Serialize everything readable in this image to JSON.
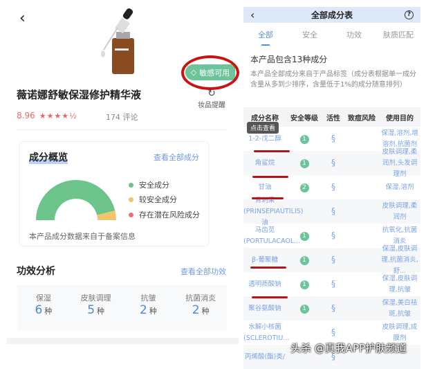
{
  "left": {
    "back_icon": "chevron-left",
    "badge": "敏感可用",
    "remind_label": "妆品提醒",
    "product_name": "薇诺娜舒敏保湿修护精华液",
    "score": "8.96",
    "stars": "★★★★½",
    "star_rating": 4.5,
    "reviews": "174 评论",
    "overview": {
      "title": "成分概览",
      "link": "查看全部成分",
      "legend": [
        {
          "label": "安全成分",
          "color": "#6cc48a"
        },
        {
          "label": "较安全成分",
          "color": "#f2c46e"
        },
        {
          "label": "存在潜在风险成分",
          "color": "#e6717a"
        }
      ],
      "gauge": {
        "safe": 12,
        "fairly_safe": 1,
        "risk": 0
      },
      "footnote": "本产品成分数据来自于备案信息"
    },
    "efficacy": {
      "title": "功效分析",
      "link": "查看全部功效",
      "items": [
        {
          "label": "保湿",
          "count": "6",
          "unit": "种"
        },
        {
          "label": "皮肤调理",
          "count": "5",
          "unit": "种"
        },
        {
          "label": "抗皱",
          "count": "2",
          "unit": "种"
        },
        {
          "label": "抗菌消炎",
          "count": "2",
          "unit": "种"
        }
      ]
    }
  },
  "right": {
    "title": "全部成分表",
    "help_icon": "?",
    "tabs": [
      "全部",
      "安全",
      "功效",
      "肤质匹配"
    ],
    "count_text": "本产品包含13种成分",
    "description": "本产品全部成分来自于产品标签（成分表根据单一成分含量从多到少排序，含量低于1%的成分随意排列）",
    "columns": [
      "成分名称",
      "安全等级",
      "活性",
      "致痘风险",
      "使用目的"
    ],
    "tooltip": "点击查看",
    "rows": [
      {
        "name": "1-2-戊二醇",
        "grade": "1",
        "purpose": "保湿,溶剂,增溶剂,抗菌剂"
      },
      {
        "name": "角鲨烷",
        "grade": "1",
        "purpose": "皮肤调理,柔润剂,头发调理剂"
      },
      {
        "name": "甘油",
        "grade": "2",
        "purpose": "保湿,溶剂"
      },
      {
        "name": "青刺果(PRINSEPIAUTILIS)油",
        "grade": "",
        "purpose": "皮肤调理,柔润剂"
      },
      {
        "name": "马齿苋(PORTULACAOL...",
        "grade": "1",
        "purpose": "抗氧化,抗菌消炎"
      },
      {
        "name": "β-葡聚糖",
        "grade": "1",
        "purpose": "保湿,皮肤调理,抗菌消炎,舒..."
      },
      {
        "name": "透明质酸钠",
        "grade": "1",
        "purpose": "保湿,皮肤调理,抗皱"
      },
      {
        "name": "聚谷氨酸钠",
        "grade": "1",
        "purpose": "保湿,美白祛斑,抗皱"
      },
      {
        "name": "水解小核菌(SCLEROTIU...",
        "grade": "",
        "purpose": "皮肤调理,成膜剂"
      },
      {
        "name": "丙烯酸(酯)类/",
        "grade": "",
        "purpose": ""
      }
    ]
  },
  "watermark": "头杀 @真我APP护肤频道"
}
